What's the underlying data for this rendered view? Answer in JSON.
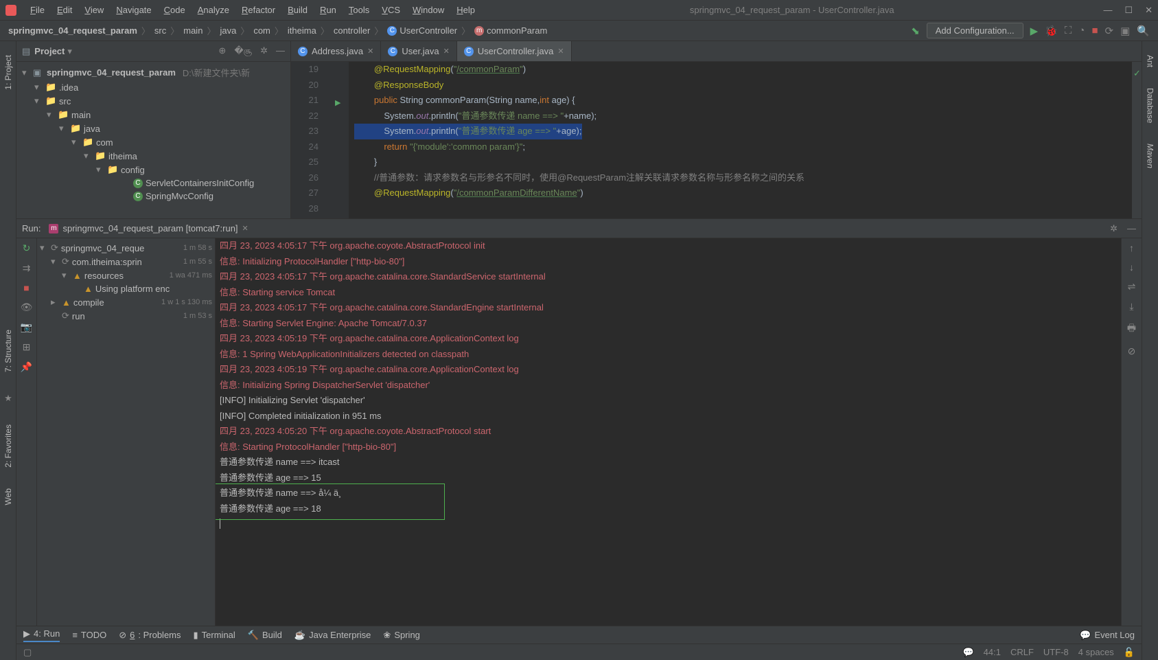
{
  "menu": [
    "File",
    "Edit",
    "View",
    "Navigate",
    "Code",
    "Analyze",
    "Refactor",
    "Build",
    "Run",
    "Tools",
    "VCS",
    "Window",
    "Help"
  ],
  "title": "springmvc_04_request_param - UserController.java",
  "breadcrumb": {
    "items": [
      "springmvc_04_request_param",
      "src",
      "main",
      "java",
      "com",
      "itheima",
      "controller",
      "UserController",
      "commonParam"
    ]
  },
  "addConfig": "Add Configuration...",
  "project": {
    "title": "Project",
    "root": "springmvc_04_request_param",
    "rootHint": "D:\\新建文件夹\\新",
    "nodes": [
      {
        "indent": 1,
        "arrow": "▾",
        "icon": "folder",
        "label": ".idea"
      },
      {
        "indent": 1,
        "arrow": "▾",
        "icon": "folder",
        "label": "src"
      },
      {
        "indent": 2,
        "arrow": "▾",
        "icon": "folder",
        "label": "main"
      },
      {
        "indent": 3,
        "arrow": "▾",
        "icon": "folder-blue",
        "label": "java"
      },
      {
        "indent": 4,
        "arrow": "▾",
        "icon": "folder",
        "label": "com"
      },
      {
        "indent": 5,
        "arrow": "▾",
        "icon": "folder",
        "label": "itheima"
      },
      {
        "indent": 6,
        "arrow": "▾",
        "icon": "folder",
        "label": "config"
      },
      {
        "indent": 7,
        "arrow": "",
        "icon": "class",
        "label": "ServletContainersInitConfig"
      },
      {
        "indent": 7,
        "arrow": "",
        "icon": "class",
        "label": "SpringMvcConfig"
      }
    ]
  },
  "tabs": [
    {
      "label": "Address.java",
      "active": false
    },
    {
      "label": "User.java",
      "active": false
    },
    {
      "label": "UserController.java",
      "active": true
    }
  ],
  "code": {
    "start": 19,
    "lines": [
      {
        "n": 19,
        "html": "        <span class='ann'>@RequestMapping</span>(<span class='str'>\"</span><span class='link'>/commonParam</span><span class='str'>\"</span>)"
      },
      {
        "n": 20,
        "html": "        <span class='ann'>@ResponseBody</span>"
      },
      {
        "n": 21,
        "html": "        <span class='kw'>public</span> <span class='type'>String</span> commonParam(<span class='type'>String</span> name,<span class='kw'>int</span> age) {",
        "run": true
      },
      {
        "n": 22,
        "html": "            System.<span class='field'>out</span>.println(<span class='str'>\"普通参数传递 name ==> \"</span>+name);"
      },
      {
        "n": 23,
        "html": "<span class='hl-line'>            System.<span class='field'>out</span>.println(<span class='str'>\"普通参数传递 age ==> \"</span>+age);</span>"
      },
      {
        "n": 24,
        "html": "            <span class='kw'>return</span> <span class='str'>\"{'module':'common param'}\"</span>;"
      },
      {
        "n": 25,
        "html": "        }"
      },
      {
        "n": 26,
        "html": ""
      },
      {
        "n": 27,
        "html": "        <span class='cmt'>//普通参数：请求参数名与形参名不同时，使用@RequestParam注解关联请求参数名称与形参名称之间的关系</span>"
      },
      {
        "n": 28,
        "html": "        <span class='ann'>@RequestMapping</span>(<span class='str'>\"</span><span class='link'>/commonParamDifferentName</span><span class='str'>\"</span>)"
      }
    ]
  },
  "run": {
    "label": "Run:",
    "config": "springmvc_04_request_param [tomcat7:run]",
    "tree": [
      {
        "indent": 0,
        "arrow": "▾",
        "icon": "spin",
        "label": "springmvc_04_reque",
        "time": "1 m 58 s"
      },
      {
        "indent": 1,
        "arrow": "▾",
        "icon": "spin",
        "label": "com.itheima:sprin",
        "time": "1 m 55 s"
      },
      {
        "indent": 2,
        "arrow": "▾",
        "icon": "warn",
        "label": "resources",
        "time": "1 wa 471 ms"
      },
      {
        "indent": 3,
        "arrow": "",
        "icon": "warn",
        "label": "Using platform enc",
        "time": ""
      },
      {
        "indent": 1,
        "arrow": "▸",
        "icon": "warn",
        "label": "compile",
        "time": "1 w 1 s 130 ms"
      },
      {
        "indent": 1,
        "arrow": "",
        "icon": "spin",
        "label": "run",
        "time": "1 m 53 s"
      }
    ]
  },
  "console": [
    {
      "cls": "red",
      "t": "四月 23, 2023 4:05:17 下午 org.apache.coyote.AbstractProtocol init"
    },
    {
      "cls": "red",
      "t": "信息: Initializing ProtocolHandler [\"http-bio-80\"]"
    },
    {
      "cls": "red",
      "t": "四月 23, 2023 4:05:17 下午 org.apache.catalina.core.StandardService startInternal"
    },
    {
      "cls": "red",
      "t": "信息: Starting service Tomcat"
    },
    {
      "cls": "red",
      "t": "四月 23, 2023 4:05:17 下午 org.apache.catalina.core.StandardEngine startInternal"
    },
    {
      "cls": "red",
      "t": "信息: Starting Servlet Engine: Apache Tomcat/7.0.37"
    },
    {
      "cls": "red",
      "t": "四月 23, 2023 4:05:19 下午 org.apache.catalina.core.ApplicationContext log"
    },
    {
      "cls": "red",
      "t": "信息: 1 Spring WebApplicationInitializers detected on classpath"
    },
    {
      "cls": "red",
      "t": "四月 23, 2023 4:05:19 下午 org.apache.catalina.core.ApplicationContext log"
    },
    {
      "cls": "red",
      "t": "信息: Initializing Spring DispatcherServlet 'dispatcher'"
    },
    {
      "cls": "nrm",
      "t": "[INFO] Initializing Servlet 'dispatcher'"
    },
    {
      "cls": "nrm",
      "t": "[INFO] Completed initialization in 951 ms"
    },
    {
      "cls": "red",
      "t": "四月 23, 2023 4:05:20 下午 org.apache.coyote.AbstractProtocol start"
    },
    {
      "cls": "red",
      "t": "信息: Starting ProtocolHandler [\"http-bio-80\"]"
    },
    {
      "cls": "nrm",
      "t": "普通参数传递 name ==> itcast"
    },
    {
      "cls": "nrm",
      "t": "普通参数传递 age ==> 15"
    },
    {
      "cls": "nrm",
      "t": "普通参数传递 name ==> å¼ ä¸"
    },
    {
      "cls": "nrm",
      "t": "普通参数传递 age ==> 18"
    }
  ],
  "bottom": {
    "run": "4: Run",
    "todo": "TODO",
    "problems": "6: Problems",
    "terminal": "Terminal",
    "build": "Build",
    "javaee": "Java Enterprise",
    "spring": "Spring",
    "eventlog": "Event Log"
  },
  "status": {
    "pos": "44:1",
    "eol": "CRLF",
    "enc": "UTF-8",
    "indent": "4 spaces"
  },
  "sideTabs": {
    "left": "1: Project",
    "rightTop": "Ant",
    "rightMid": "Database",
    "rightMaven": "Maven",
    "leftStruct": "7: Structure",
    "leftFav": "2: Favorites",
    "leftWeb": "Web"
  }
}
